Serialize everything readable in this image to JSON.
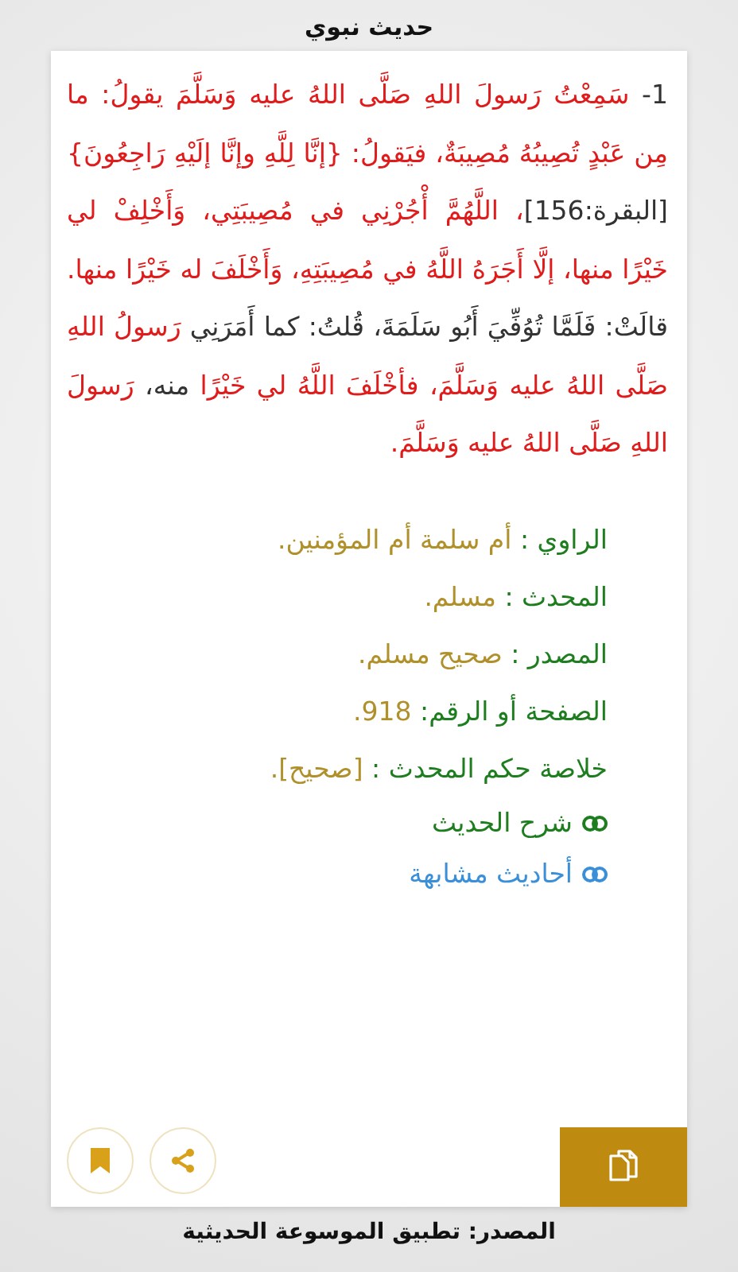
{
  "header": {
    "title": "حديث نبوي"
  },
  "hadith": {
    "segments": [
      {
        "kind": "plain",
        "text": "1- "
      },
      {
        "kind": "quote",
        "text": "سَمِعْتُ رَسولَ اللهِ صَلَّى اللهُ عليه وَسَلَّمَ يقولُ: ما مِن عَبْدٍ تُصِيبُهُ مُصِيبَةٌ، فيَقولُ: {إنَّا لِلَّهِ وإنَّا إلَيْهِ رَاجِعُونَ} "
      },
      {
        "kind": "plain",
        "text": "[البقرة:156]"
      },
      {
        "kind": "quote",
        "text": "، اللَّهُمَّ أْجُرْنِي في مُصِيبَتِي، وَأَخْلِفْ لي خَيْرًا منها، إلَّا أَجَرَهُ اللَّهُ في مُصِيبَتِهِ، وَأَخْلَفَ له خَيْرًا منها."
      },
      {
        "kind": "plain",
        "text": " قالَتْ: فَلَمَّا تُوُفِّيَ أَبُو سَلَمَةَ، قُلتُ: كما أَمَرَنِي "
      },
      {
        "kind": "quote",
        "text": "رَسولُ اللهِ صَلَّى اللهُ عليه وَسَلَّمَ، فأخْلَفَ اللَّهُ لي خَيْرًا "
      },
      {
        "kind": "plain",
        "text": "منه، "
      },
      {
        "kind": "quote",
        "text": "رَسولَ اللهِ صَلَّى اللهُ عليه وَسَلَّمَ."
      }
    ]
  },
  "info": [
    {
      "label": "الراوي :",
      "value": "أم سلمة أم المؤمنين."
    },
    {
      "label": "المحدث :",
      "value": "مسلم."
    },
    {
      "label": "المصدر :",
      "value": "صحيح مسلم."
    },
    {
      "label": "الصفحة أو الرقم:",
      "value": "918."
    },
    {
      "label": "خلاصة حكم المحدث :",
      "value": "[صحيح]."
    }
  ],
  "links": [
    {
      "label": "شرح الحديث",
      "color": "#1e7d1e"
    },
    {
      "label": "أحاديث مشابهة",
      "color": "#3a8fd8"
    }
  ],
  "footer": {
    "source": "المصدر: تطبيق الموسوعة الحديثية"
  }
}
